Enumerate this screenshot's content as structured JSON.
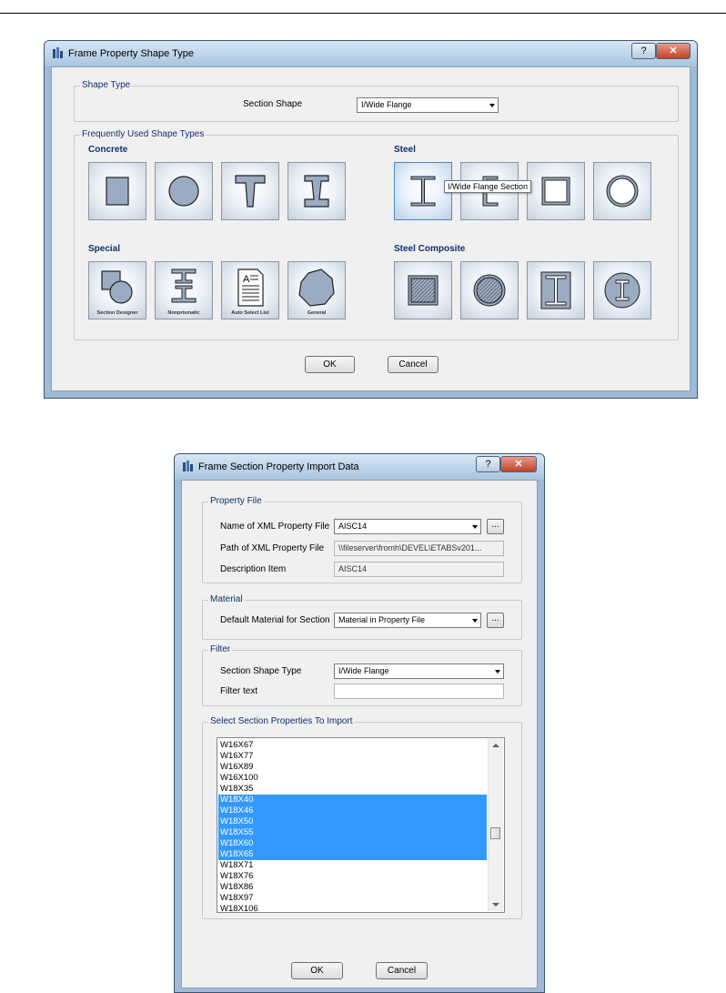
{
  "shape_dialog": {
    "title": "Frame Property Shape Type",
    "help_label": "?",
    "close_label": "✕",
    "shape_type_group": "Shape Type",
    "section_shape_label": "Section Shape",
    "section_shape_value": "I/Wide Flange",
    "frequent_group": "Frequently Used Shape Types",
    "concrete_label": "Concrete",
    "steel_label": "Steel",
    "special_label": "Special",
    "steel_composite_label": "Steel Composite",
    "special_captions": [
      "Section Designer",
      "Nonprismatic",
      "Auto Select List",
      "General"
    ],
    "tooltip": "I/Wide Flange Section",
    "ok_label": "OK",
    "cancel_label": "Cancel"
  },
  "import_dialog": {
    "title": "Frame Section Property Import Data",
    "help_label": "?",
    "close_label": "✕",
    "property_file_group": "Property File",
    "xml_file_label": "Name of XML Property File",
    "xml_file_value": "AISC14",
    "ellipsis_label": "...",
    "path_label": "Path of XML Property File",
    "path_value": "\\\\fileserver\\fromh\\DEVEL\\ETABSv201...",
    "description_label": "Description Item",
    "description_value": "AISC14",
    "material_group": "Material",
    "default_material_label": "Default Material for Section",
    "default_material_value": "Material in Property File",
    "filter_group": "Filter",
    "section_shape_type_label": "Section Shape Type",
    "section_shape_type_value": "I/Wide Flange",
    "filter_text_label": "Filter text",
    "filter_text_value": "",
    "select_group": "Select Section Properties To Import",
    "sections": [
      {
        "name": "W16X67",
        "selected": false
      },
      {
        "name": "W16X77",
        "selected": false
      },
      {
        "name": "W16X89",
        "selected": false
      },
      {
        "name": "W16X100",
        "selected": false
      },
      {
        "name": "W18X35",
        "selected": false
      },
      {
        "name": "W18X40",
        "selected": true
      },
      {
        "name": "W18X46",
        "selected": true
      },
      {
        "name": "W18X50",
        "selected": true
      },
      {
        "name": "W18X55",
        "selected": true
      },
      {
        "name": "W18X60",
        "selected": true
      },
      {
        "name": "W18X65",
        "selected": true
      },
      {
        "name": "W18X71",
        "selected": false
      },
      {
        "name": "W18X76",
        "selected": false
      },
      {
        "name": "W18X86",
        "selected": false
      },
      {
        "name": "W18X97",
        "selected": false
      },
      {
        "name": "W18X106",
        "selected": false
      }
    ],
    "ok_label": "OK",
    "cancel_label": "Cancel"
  },
  "colors": {
    "selection": "#3399ff",
    "group_label": "#10306e",
    "shape_fill": "#9aabc2",
    "title_gradient_top": "#d7e6f5"
  }
}
